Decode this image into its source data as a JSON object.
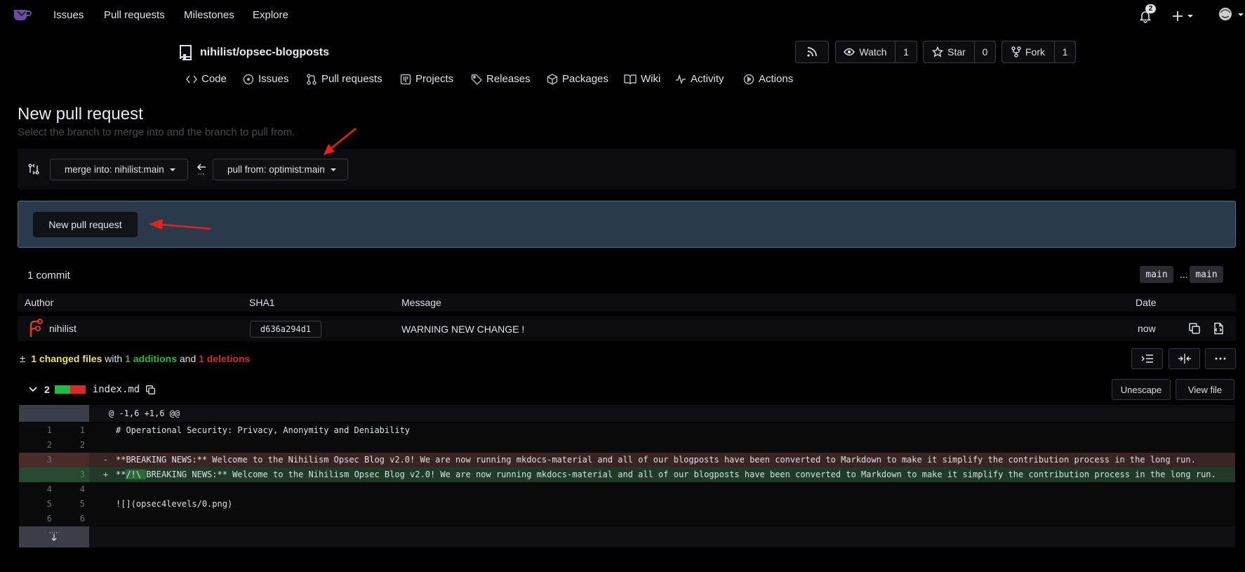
{
  "nav": {
    "links": [
      "Issues",
      "Pull requests",
      "Milestones",
      "Explore"
    ],
    "notification_count": "2"
  },
  "repo": {
    "owner": "nihilist",
    "separator": "/",
    "name": "opsec-blogposts",
    "watch_label": "Watch",
    "watch_count": "1",
    "star_label": "Star",
    "star_count": "0",
    "fork_label": "Fork",
    "fork_count": "1"
  },
  "tabs": [
    {
      "label": "Code",
      "icon": "code-icon"
    },
    {
      "label": "Issues",
      "icon": "issue-icon"
    },
    {
      "label": "Pull requests",
      "icon": "pull-request-icon"
    },
    {
      "label": "Projects",
      "icon": "project-icon"
    },
    {
      "label": "Releases",
      "icon": "tag-icon"
    },
    {
      "label": "Packages",
      "icon": "package-icon"
    },
    {
      "label": "Wiki",
      "icon": "book-icon"
    },
    {
      "label": "Activity",
      "icon": "pulse-icon"
    },
    {
      "label": "Actions",
      "icon": "play-icon"
    }
  ],
  "page": {
    "title": "New pull request",
    "subtitle": "Select the branch to merge into and the branch to pull from."
  },
  "branches": {
    "merge_into": "merge into: nihilist:main",
    "pull_from": "pull from: optimist:main",
    "new_pr_button": "New pull request"
  },
  "commits": {
    "count_label": "1 commit",
    "base_branch": "main",
    "ellipsis": "...",
    "head_branch": "main",
    "headers": {
      "author": "Author",
      "sha": "SHA1",
      "message": "Message",
      "date": "Date"
    },
    "rows": [
      {
        "author": "nihilist",
        "sha": "d636a294d1",
        "message": "WARNING NEW CHANGE !",
        "date": "now"
      }
    ]
  },
  "diff_stats": {
    "toggle": "±",
    "files": "1 changed files",
    "with": "with",
    "additions": "1 additions",
    "and": "and",
    "deletions": "1 deletions"
  },
  "file": {
    "change_count": "2",
    "name": "index.md",
    "unescape_button": "Unescape",
    "view_file_button": "View file"
  },
  "diff": {
    "hunk": "@ -1,6 +1,6 @@",
    "lines": [
      {
        "type": "plain",
        "old": "1",
        "new": "1",
        "sign": "",
        "text": "# Operational Security: Privacy, Anonymity and Deniability"
      },
      {
        "type": "plain",
        "old": "2",
        "new": "2",
        "sign": "",
        "text": ""
      },
      {
        "type": "del",
        "old": "3",
        "new": "",
        "sign": "-",
        "text": "**BREAKING NEWS:** Welcome to the Nihilism Opsec Blog v2.0! We are now running mkdocs-material and all of our blogposts have been converted to Markdown to make it simplify the contribution process in the long run."
      },
      {
        "type": "add",
        "old": "",
        "new": "3",
        "sign": "+",
        "pre": "**",
        "hl": "/!\\ ",
        "text": "BREAKING NEWS:** Welcome to the Nihilism Opsec Blog v2.0! We are now running mkdocs-material and all of our blogposts have been converted to Markdown to make it simplify the contribution process in the long run."
      },
      {
        "type": "plain",
        "old": "4",
        "new": "4",
        "sign": "",
        "text": ""
      },
      {
        "type": "plain",
        "old": "5",
        "new": "5",
        "sign": "",
        "text": "![](opsec4levels/0.png)"
      },
      {
        "type": "plain",
        "old": "6",
        "new": "6",
        "sign": "",
        "text": ""
      }
    ]
  },
  "colors": {
    "accent_annotation": "#e8201b",
    "additions": "#21ba45",
    "deletions": "#db2828",
    "files": "#f3e06a"
  }
}
